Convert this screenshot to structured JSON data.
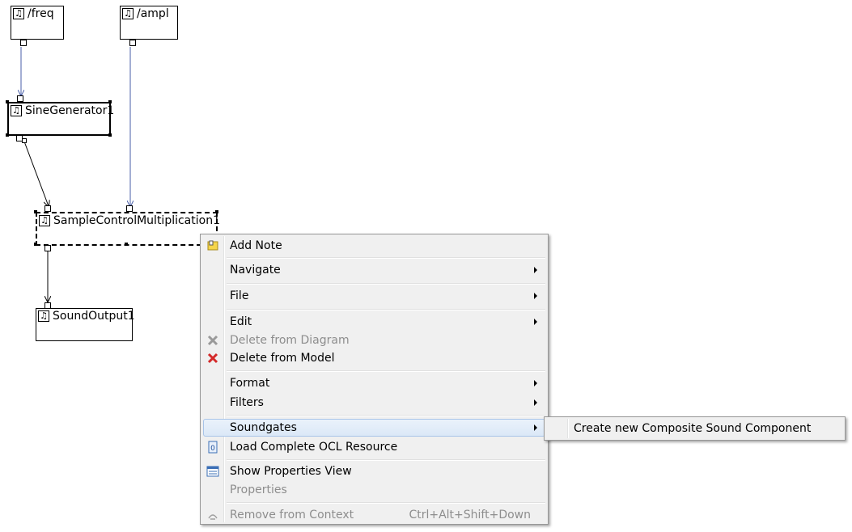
{
  "nodes": {
    "freq": {
      "label": "/freq"
    },
    "ampl": {
      "label": "/ampl"
    },
    "sine": {
      "label": "SineGenerator1"
    },
    "mult": {
      "label": "SampleControlMultiplication1"
    },
    "out": {
      "label": "SoundOutput1"
    }
  },
  "node_icon": "music-note-icon",
  "context_menu": {
    "add_note": "Add Note",
    "navigate": "Navigate",
    "file": "File",
    "edit": "Edit",
    "delete_diagram": "Delete from Diagram",
    "delete_model": "Delete from Model",
    "format": "Format",
    "filters": "Filters",
    "soundgates": "Soundgates",
    "load_ocl": "Load Complete OCL Resource",
    "show_properties": "Show Properties View",
    "properties": "Properties",
    "remove_context": "Remove from Context",
    "remove_context_shortcut": "Ctrl+Alt+Shift+Down"
  },
  "submenu": {
    "create_composite": "Create new Composite Sound Component"
  },
  "colors": {
    "connection_blue": "#4a5fa8",
    "connection_black": "#000000",
    "menu_bg": "#f0f0f0",
    "hover_bg": "#dbe8f7",
    "disabled_text": "#8d8d8d",
    "delete_red": "#d42a2a"
  }
}
